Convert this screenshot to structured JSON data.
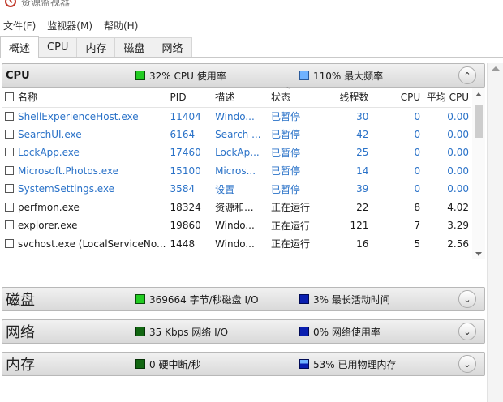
{
  "window": {
    "title": "资源监视器"
  },
  "menu": [
    "文件(F)",
    "监视器(M)",
    "帮助(H)"
  ],
  "tabs": [
    "概述",
    "CPU",
    "内存",
    "磁盘",
    "网络"
  ],
  "colors": {
    "green": "#22cc22",
    "dark_green": "#116611",
    "blue": "#6fb2ff",
    "dark_blue": "#0a1fb0",
    "suspended": "#2a72c8"
  },
  "cpu": {
    "title": "CPU",
    "stat1": "32% CPU 使用率",
    "stat2": "110% 最大频率",
    "toggle": "⌃",
    "columns": [
      "名称",
      "PID",
      "描述",
      "状态",
      "线程数",
      "CPU",
      "平均 CPU"
    ],
    "rows": [
      {
        "name": "ShellExperienceHost.exe",
        "pid": "11404",
        "desc": "Windo...",
        "status": "已暂停",
        "threads": "30",
        "cpu": "0",
        "avg": "0.00",
        "suspended": true
      },
      {
        "name": "SearchUI.exe",
        "pid": "6164",
        "desc": "Search ...",
        "status": "已暂停",
        "threads": "42",
        "cpu": "0",
        "avg": "0.00",
        "suspended": true
      },
      {
        "name": "LockApp.exe",
        "pid": "17460",
        "desc": "LockAp...",
        "status": "已暂停",
        "threads": "25",
        "cpu": "0",
        "avg": "0.00",
        "suspended": true
      },
      {
        "name": "Microsoft.Photos.exe",
        "pid": "15100",
        "desc": "Micros...",
        "status": "已暂停",
        "threads": "14",
        "cpu": "0",
        "avg": "0.00",
        "suspended": true
      },
      {
        "name": "SystemSettings.exe",
        "pid": "3584",
        "desc": "设置",
        "status": "已暂停",
        "threads": "39",
        "cpu": "0",
        "avg": "0.00",
        "suspended": true
      },
      {
        "name": "perfmon.exe",
        "pid": "18324",
        "desc": "资源和...",
        "status": "正在运行",
        "threads": "22",
        "cpu": "8",
        "avg": "4.02",
        "suspended": false
      },
      {
        "name": "explorer.exe",
        "pid": "19860",
        "desc": "Windo...",
        "status": "正在运行",
        "threads": "121",
        "cpu": "7",
        "avg": "3.29",
        "suspended": false
      },
      {
        "name": "svchost.exe (LocalServiceNo...",
        "pid": "1448",
        "desc": "Windo...",
        "status": "正在运行",
        "threads": "16",
        "cpu": "5",
        "avg": "2.56",
        "suspended": false
      }
    ]
  },
  "disk": {
    "title": "磁盘",
    "stat1": "369664 字节/秒磁盘 I/O",
    "stat2": "3% 最长活动时间",
    "toggle": "⌄"
  },
  "network": {
    "title": "网络",
    "stat1": "35 Kbps 网络 I/O",
    "stat2": "0% 网络使用率",
    "toggle": "⌄"
  },
  "memory": {
    "title": "内存",
    "stat1": "0 硬中断/秒",
    "stat2": "53% 已用物理内存",
    "toggle": "⌄"
  }
}
